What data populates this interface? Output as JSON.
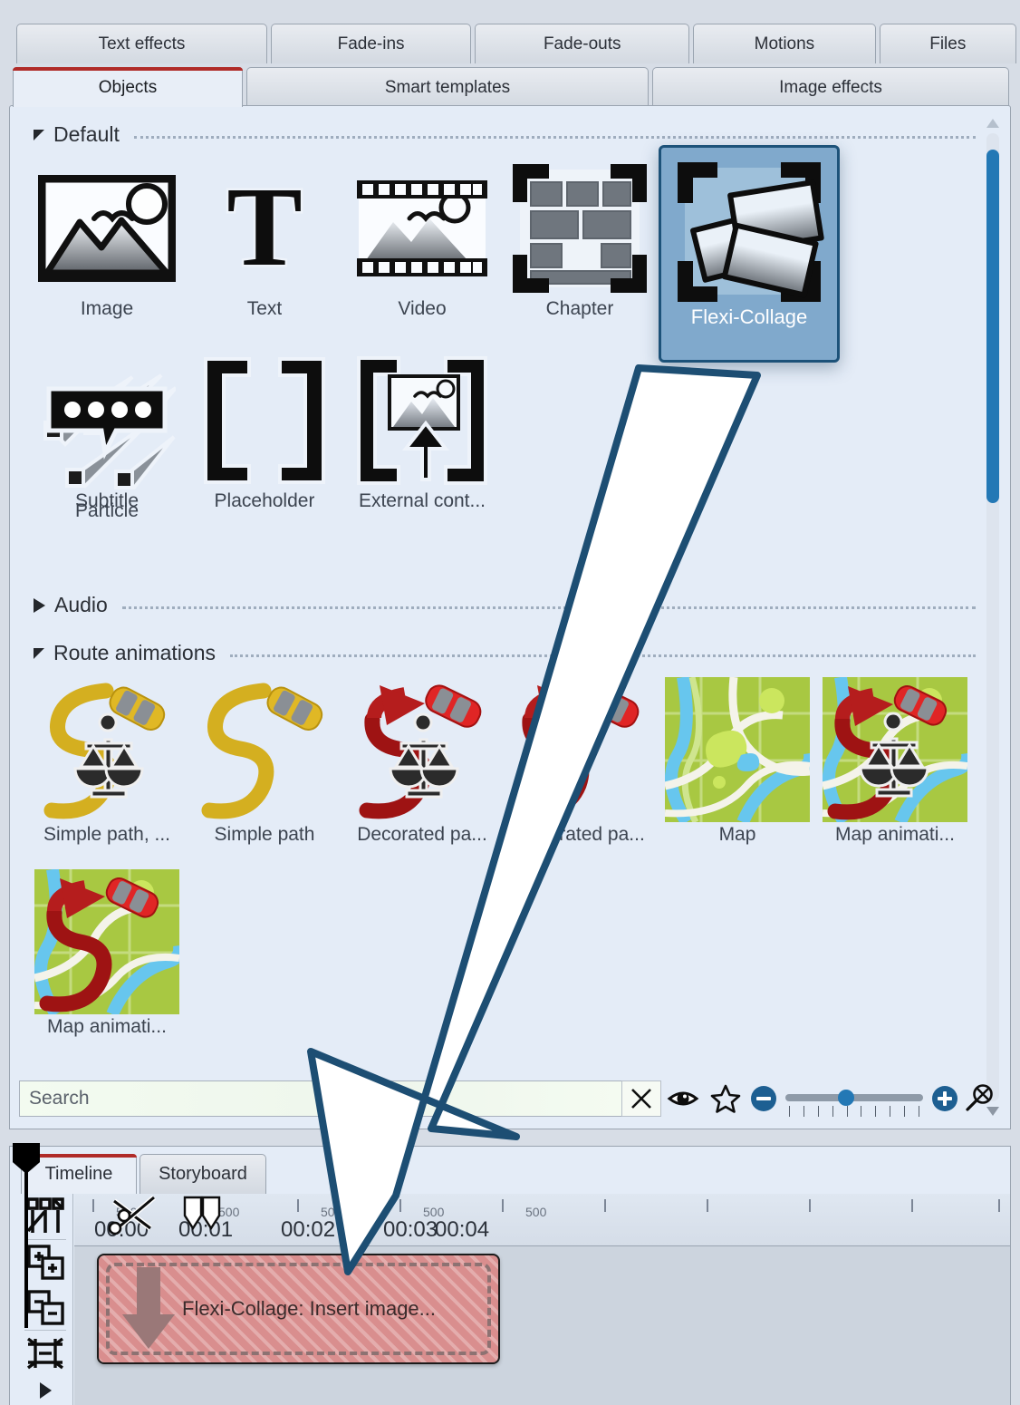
{
  "window": {
    "top_tabs": [
      {
        "label": "Text effects",
        "active": false
      },
      {
        "label": "Fade-ins",
        "active": false
      },
      {
        "label": "Fade-outs",
        "active": false
      },
      {
        "label": "Motions",
        "active": false
      },
      {
        "label": "Files",
        "active": false
      }
    ],
    "second_tabs": [
      {
        "label": "Objects",
        "active": true
      },
      {
        "label": "Smart templates",
        "active": false
      },
      {
        "label": "Image effects",
        "active": false
      }
    ]
  },
  "groups": {
    "default": {
      "title": "Default",
      "expanded": true,
      "items": [
        {
          "label": "Image",
          "icon": "image-icon",
          "selected": false
        },
        {
          "label": "Text",
          "icon": "text-icon",
          "selected": false
        },
        {
          "label": "Video",
          "icon": "video-icon",
          "selected": false
        },
        {
          "label": "Chapter",
          "icon": "chapter-icon",
          "selected": false
        },
        {
          "label": "Flexi-Collage",
          "icon": "flexi-collage-icon",
          "selected": true
        },
        {
          "label": "Particle",
          "icon": "particle-icon",
          "selected": false
        },
        {
          "label": "Subtitle",
          "icon": "subtitle-icon",
          "selected": false
        },
        {
          "label": "Placeholder",
          "icon": "placeholder-icon",
          "selected": false
        },
        {
          "label": "External cont...",
          "icon": "external-content-icon",
          "selected": false
        }
      ]
    },
    "audio": {
      "title": "Audio",
      "expanded": false,
      "items": []
    },
    "route_animations": {
      "title": "Route animations",
      "expanded": true,
      "items": [
        {
          "label": "Simple path, ...",
          "icon": "simple-path-scales-icon"
        },
        {
          "label": "Simple path",
          "icon": "simple-path-icon"
        },
        {
          "label": "Decorated pa...",
          "icon": "decorated-path-scales-icon"
        },
        {
          "label": "Decorated pa...",
          "icon": "decorated-path-icon"
        },
        {
          "label": "Map",
          "icon": "map-icon"
        },
        {
          "label": "Map animati...",
          "icon": "map-animation-scales-icon"
        },
        {
          "label": "Map animati...",
          "icon": "map-animation-icon"
        }
      ]
    }
  },
  "search": {
    "placeholder": "Search",
    "value": "",
    "clear_icon": "close-icon",
    "preview_icon": "eye-icon",
    "favorite_icon": "star-icon",
    "zoom_out_icon": "minus-circle-icon",
    "zoom_in_icon": "plus-circle-icon",
    "reset_zoom_icon": "reset-zoom-icon",
    "zoom_level": 40
  },
  "timeline": {
    "tabs": [
      {
        "label": "Timeline",
        "active": true
      },
      {
        "label": "Storyboard",
        "active": false
      }
    ],
    "sidebar_icons": [
      "track-objects-icon",
      "add-track-icon",
      "remove-track-icon",
      "fit-view-icon",
      "expand-icon"
    ],
    "ruler": {
      "seconds": [
        "00:00",
        "00:01",
        "00:02",
        "00:03",
        "00:04"
      ],
      "sub_label": "500"
    },
    "tools": {
      "scissors_icon": "scissors-icon",
      "marker_icon": "marker-icon",
      "playhead_icon": "playhead-icon"
    },
    "clip": {
      "title": "Flexi-Collage: Insert image...",
      "drop_arrow_icon": "down-arrow-icon",
      "color": "#d98e8e"
    }
  },
  "annotation": {
    "arrow_icon": "pointer-arrow-annotation",
    "stroke_color": "#1d4e73",
    "fill_color": "#ffffff"
  },
  "colors": {
    "panel_bg": "#e4ecf7",
    "selection_bg": "#80a9cc",
    "selection_border": "#1d5279",
    "accent_red": "#b02b28",
    "scrollbar_thumb": "#2378b5"
  }
}
